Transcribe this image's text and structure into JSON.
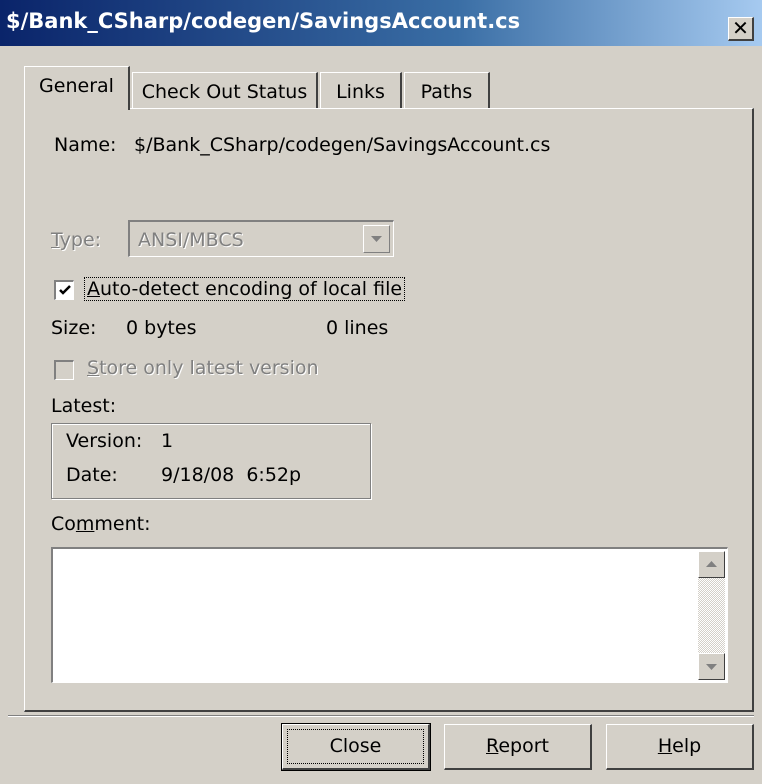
{
  "window": {
    "title": "$/Bank_CSharp/codegen/SavingsAccount.cs",
    "close_glyph": "✕"
  },
  "tabs": [
    {
      "label": "General",
      "active": true
    },
    {
      "label": "Check Out Status",
      "active": false
    },
    {
      "label": "Links",
      "active": false
    },
    {
      "label": "Paths",
      "active": false
    }
  ],
  "general": {
    "name_label": "Name:",
    "name_value": "$/Bank_CSharp/codegen/SavingsAccount.cs",
    "type_label_underlined": "T",
    "type_label_rest": "ype:",
    "type_value": "ANSI/MBCS",
    "auto_detect_checked": true,
    "auto_detect_underlined": "A",
    "auto_detect_rest": "uto-detect encoding of local file",
    "size_label": "Size:",
    "size_bytes": "0 bytes",
    "size_lines": "0 lines",
    "store_latest_checked": false,
    "store_latest_underlined": "S",
    "store_latest_rest": "tore only latest version",
    "latest_label": "Latest:",
    "version_label": "Version:",
    "version_value": "1",
    "date_label": "Date:",
    "date_value": "9/18/08  6:52p",
    "comment_label_pre": "Co",
    "comment_label_underlined": "m",
    "comment_label_rest": "ment:",
    "comment_value": ""
  },
  "buttons": {
    "close_label": "Close",
    "report_underlined": "R",
    "report_rest": "eport",
    "help_underlined": "H",
    "help_rest": "elp"
  },
  "icons": {
    "scroll_up": "scroll-up-arrow-icon",
    "scroll_down": "scroll-down-arrow-icon",
    "dropdown": "chevron-down-icon",
    "check": "checkmark-icon"
  }
}
